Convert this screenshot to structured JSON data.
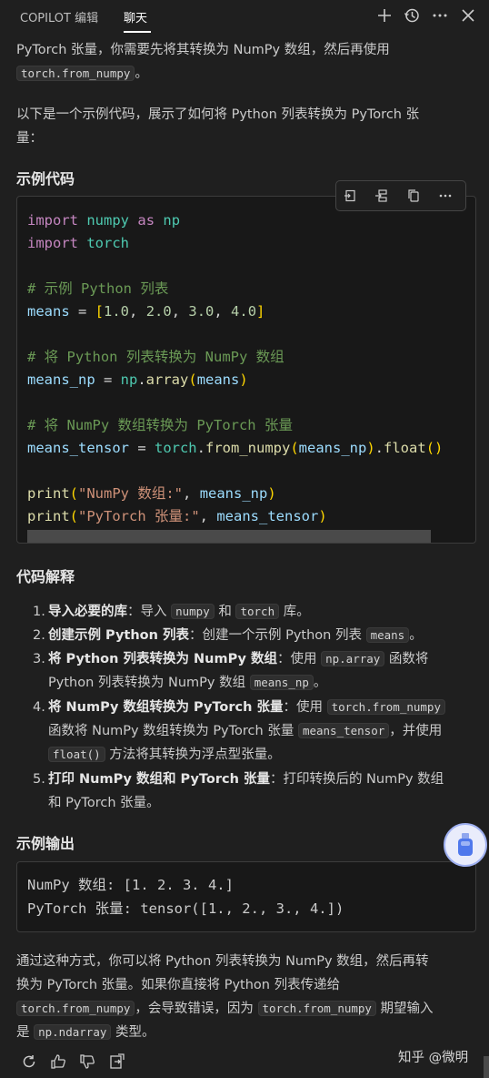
{
  "topbar": {
    "tabs": [
      {
        "label": "COPILOT 编辑"
      },
      {
        "label": "聊天"
      }
    ],
    "icons": [
      "plus-icon",
      "history-icon",
      "more-icon",
      "close-icon"
    ]
  },
  "intro": {
    "line1": "PyTorch 张量，你需要先将其转换为 NumPy 数组，然后再使用",
    "code1": "torch.from_numpy",
    "line1_end": "。",
    "line2": "以下是一个示例代码，展示了如何将 Python 列表转换为 PyTorch 张",
    "line3": "量："
  },
  "section_example": {
    "title": "示例代码"
  },
  "code_toolbar": {
    "icons": [
      "apply-in-editor-icon",
      "insert-at-cursor-icon",
      "copy-icon",
      "more-actions-icon"
    ]
  },
  "code": {
    "l1_kw": "import",
    "l1_mod": "numpy",
    "l1_as": "as",
    "l1_alias": "np",
    "l2_kw": "import",
    "l2_mod": "torch",
    "l4_cm": "# 示例 Python 列表",
    "l5_id": "means",
    "l5_eq": " = ",
    "l5_b1": "[",
    "l5_nums": [
      "1.0",
      "2.0",
      "3.0",
      "4.0"
    ],
    "l5_b2": "]",
    "l7_cm": "# 将 Python 列表转换为 NumPy 数组",
    "l8_id": "means_np",
    "l8_eq": " = ",
    "l8_mod": "np",
    "l8_fn": "array",
    "l8_arg": "means",
    "l10_cm": "# 将 NumPy 数组转换为 PyTorch 张量",
    "l11_id": "means_tensor",
    "l11_eq": " = ",
    "l11_mod": "torch",
    "l11_fn": "from_numpy",
    "l11_arg": "means_np",
    "l11_fn2": "float",
    "l13_fn": "print",
    "l13_st": "\"NumPy 数组:\"",
    "l13_arg": "means_np",
    "l14_fn": "print",
    "l14_st": "\"PyTorch 张量:\"",
    "l14_arg": "means_tensor"
  },
  "section_explain": {
    "title": "代码解释"
  },
  "explain": {
    "i1": {
      "num": "1.",
      "bold": "导入必要的库",
      "a": "：导入 ",
      "c1": "numpy",
      "b": " 和 ",
      "c2": "torch",
      "c": " 库。"
    },
    "i2": {
      "num": "2.",
      "bold": "创建示例 Python 列表",
      "a": "：创建一个示例 Python 列表 ",
      "c1": "means",
      "b": "。"
    },
    "i3": {
      "num": "3.",
      "bold": "将 Python 列表转换为 NumPy 数组",
      "a": "：使用 ",
      "c1": "np.array",
      "b": " 函数将",
      "l2": "Python 列表转换为 NumPy 数组 ",
      "c2": "means_np",
      "c": "。"
    },
    "i4": {
      "num": "4.",
      "bold": "将 NumPy 数组转换为 PyTorch 张量",
      "a": "：使用 ",
      "c1": "torch.from_numpy",
      "l2": "函数将 NumPy 数组转换为 PyTorch 张量 ",
      "c2": "means_tensor",
      "b": "，并使用",
      "c3": "float()",
      "c": " 方法将其转换为浮点型张量。"
    },
    "i5": {
      "num": "5.",
      "bold": "打印 NumPy 数组和 PyTorch 张量",
      "a": "：打印转换后的 NumPy 数组",
      "l2": "和 PyTorch 张量。"
    }
  },
  "section_output": {
    "title": "示例输出"
  },
  "output": {
    "l1": "NumPy 数组: [1. 2. 3. 4.]",
    "l2": "PyTorch 张量: tensor([1., 2., 3., 4.])"
  },
  "outro": {
    "line1": "通过这种方式，你可以将 Python 列表转换为 NumPy 数组，然后再转",
    "line2": "换为 PyTorch 张量。如果你直接将 Python 列表传递给",
    "c1": "torch.from_numpy",
    "a": "，会导致错误，因为 ",
    "c2": "torch.from_numpy",
    "b": " 期望输入",
    "l4a": "是 ",
    "c3": "np.ndarray",
    "l4b": " 类型。"
  },
  "bottom": {
    "icons": [
      "retry-icon",
      "thumbs-up-icon",
      "thumbs-down-icon",
      "insert-into-new-file-icon"
    ]
  },
  "watermark": "知乎 @微明"
}
